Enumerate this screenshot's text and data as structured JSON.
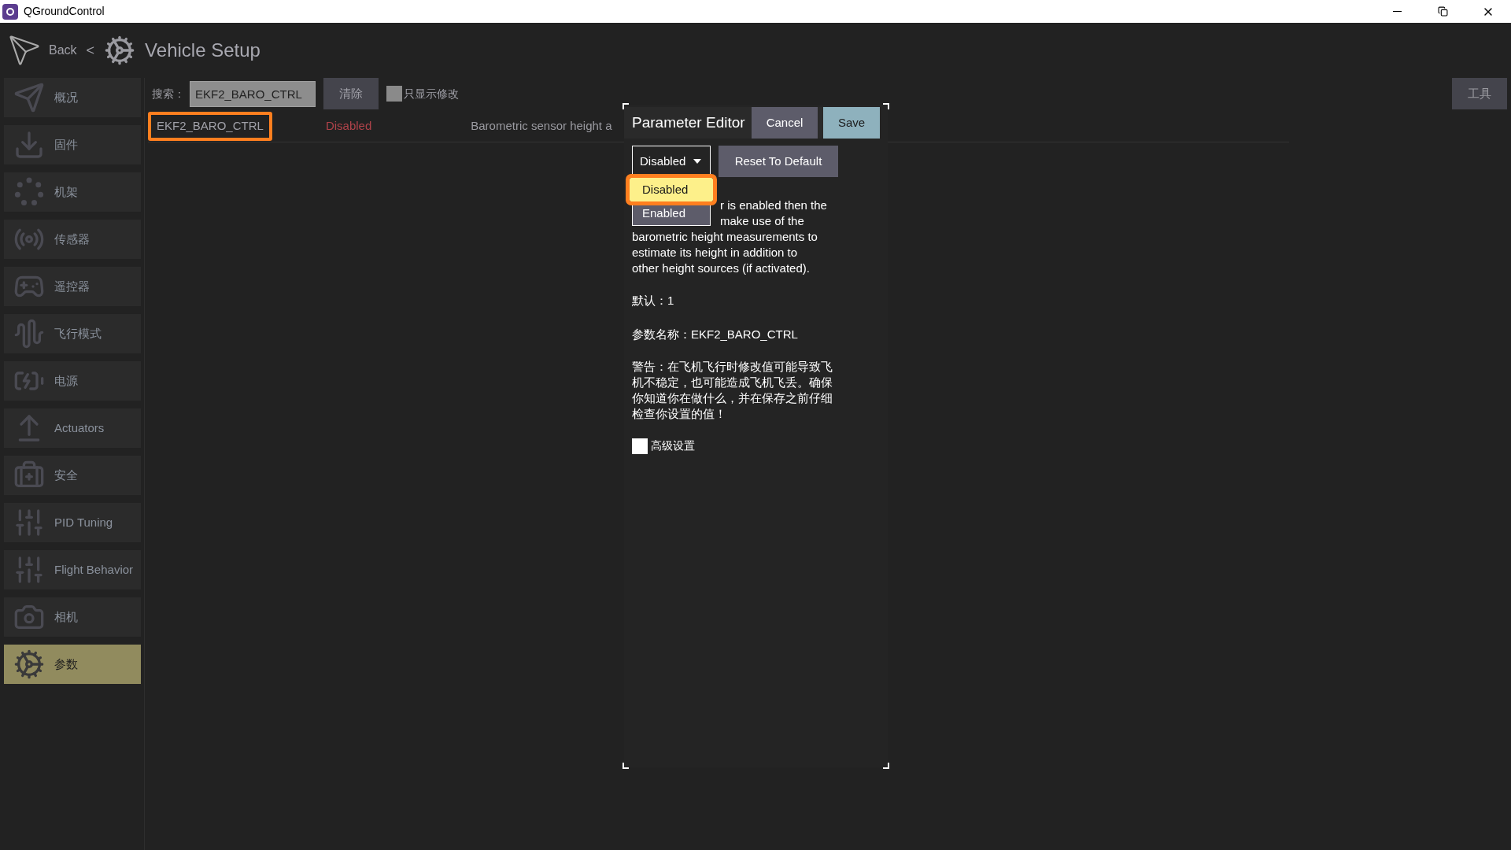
{
  "window": {
    "title": "QGroundControl"
  },
  "header": {
    "back": "Back",
    "separator": "<",
    "title": "Vehicle Setup"
  },
  "sidebar": {
    "items": [
      {
        "label": "概况",
        "kind": "plane",
        "selected": false
      },
      {
        "label": "固件",
        "kind": "download",
        "selected": false
      },
      {
        "label": "机架",
        "kind": "dots",
        "selected": false
      },
      {
        "label": "传感器",
        "kind": "radio",
        "selected": false
      },
      {
        "label": "遥控器",
        "kind": "gamepad",
        "selected": false
      },
      {
        "label": "飞行模式",
        "kind": "wave",
        "selected": false
      },
      {
        "label": "电源",
        "kind": "battery",
        "selected": false
      },
      {
        "label": "Actuators",
        "kind": "actuator",
        "selected": false
      },
      {
        "label": "安全",
        "kind": "medkit",
        "selected": false
      },
      {
        "label": "PID Tuning",
        "kind": "sliders",
        "selected": false
      },
      {
        "label": "Flight Behavior",
        "kind": "sliders",
        "selected": false
      },
      {
        "label": "相机",
        "kind": "camera",
        "selected": false
      },
      {
        "label": "参数",
        "kind": "gears",
        "selected": true
      }
    ]
  },
  "toolbar": {
    "search_label": "搜索：",
    "search_value": "EKF2_BARO_CTRL",
    "clear_button": "清除",
    "modified_only": {
      "label": "只显示修改",
      "checked": false
    },
    "tools_button": "工具"
  },
  "table": {
    "rows": [
      {
        "name": "EKF2_BARO_CTRL",
        "value": "Disabled",
        "description": "Barometric sensor height a"
      }
    ]
  },
  "dialog": {
    "title": "Parameter Editor",
    "cancel": "Cancel",
    "save": "Save",
    "combo": {
      "value": "Disabled",
      "expanded": true,
      "options": [
        {
          "label": "Disabled",
          "selected": true
        },
        {
          "label": "Enabled",
          "selected": false
        }
      ]
    },
    "reset_button": "Reset To Default",
    "description_lines": [
      "r is enabled then the",
      "make use of the",
      "barometric height measurements to",
      "estimate its height in addition to",
      "other height sources (if activated)."
    ],
    "default": "默认：1",
    "param_name": "参数名称：EKF2_BARO_CTRL",
    "warning": "警告：在飞机飞行时修改值可能导致飞机不稳定，也可能造成飞机飞丢。确保你知道你在做什么，并在保存之前仔细检查你设置的值！",
    "advanced": {
      "label": "高级设置",
      "checked": false
    }
  }
}
